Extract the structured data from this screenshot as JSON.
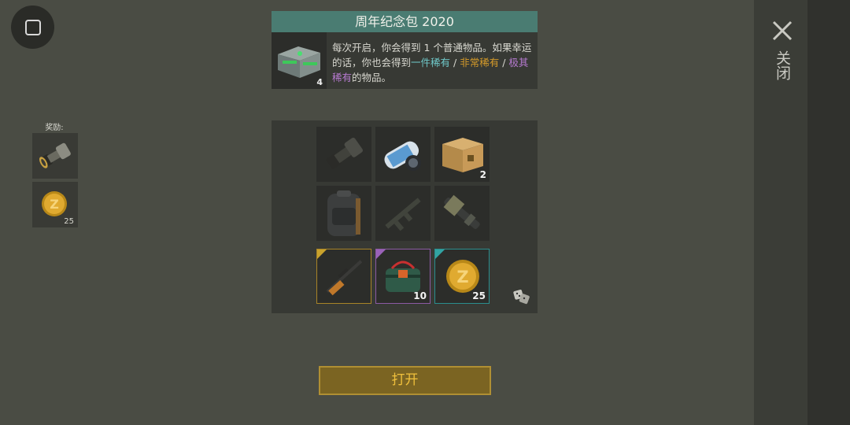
{
  "hud": {
    "menu_icon": "square-stop-icon",
    "close_icon": "close-x-icon",
    "close_label": "关闭"
  },
  "rewards": {
    "title": "奖励:",
    "items": [
      {
        "icon": "scope-lens-icon",
        "count": ""
      },
      {
        "icon": "gold-coin-icon",
        "count": "25"
      }
    ]
  },
  "pack": {
    "title": "周年纪念包 2020",
    "icon": "green-crate-icon",
    "count": "4",
    "desc_part1": "每次开启，你会得到 1 个普通物品。如果幸运的话，你也会得到",
    "rarity_rare": "一件稀有",
    "sep1": " / ",
    "rarity_very_rare": "非常稀有",
    "sep2": " / ",
    "rarity_epic": "极其稀有",
    "desc_part2": "的物品。"
  },
  "grid": {
    "items": [
      {
        "icon": "scope-lens-icon",
        "count": "",
        "dimmed": true
      },
      {
        "icon": "blueprint-roll-icon",
        "count": ""
      },
      {
        "icon": "cardboard-box-icon",
        "count": "2"
      },
      {
        "icon": "backpack-icon",
        "count": ""
      },
      {
        "icon": "rifle-icon",
        "count": "",
        "dimmed": true
      },
      {
        "icon": "mounted-gun-icon",
        "count": ""
      },
      {
        "icon": "sniper-rifle-icon",
        "count": "",
        "tier": "gold"
      },
      {
        "icon": "dynamite-bundle-icon",
        "count": "10",
        "tier": "purple"
      },
      {
        "icon": "gold-coin-icon",
        "count": "25",
        "tier": "teal"
      }
    ],
    "dice_icon": "dice-icon"
  },
  "colors": {
    "title_bar": "#4a7c72",
    "rare": "#6fc8c8",
    "very_rare": "#d49a2a",
    "epic": "#b67ad0",
    "button_text": "#f0c03c"
  },
  "open_button": {
    "label": "打开"
  }
}
